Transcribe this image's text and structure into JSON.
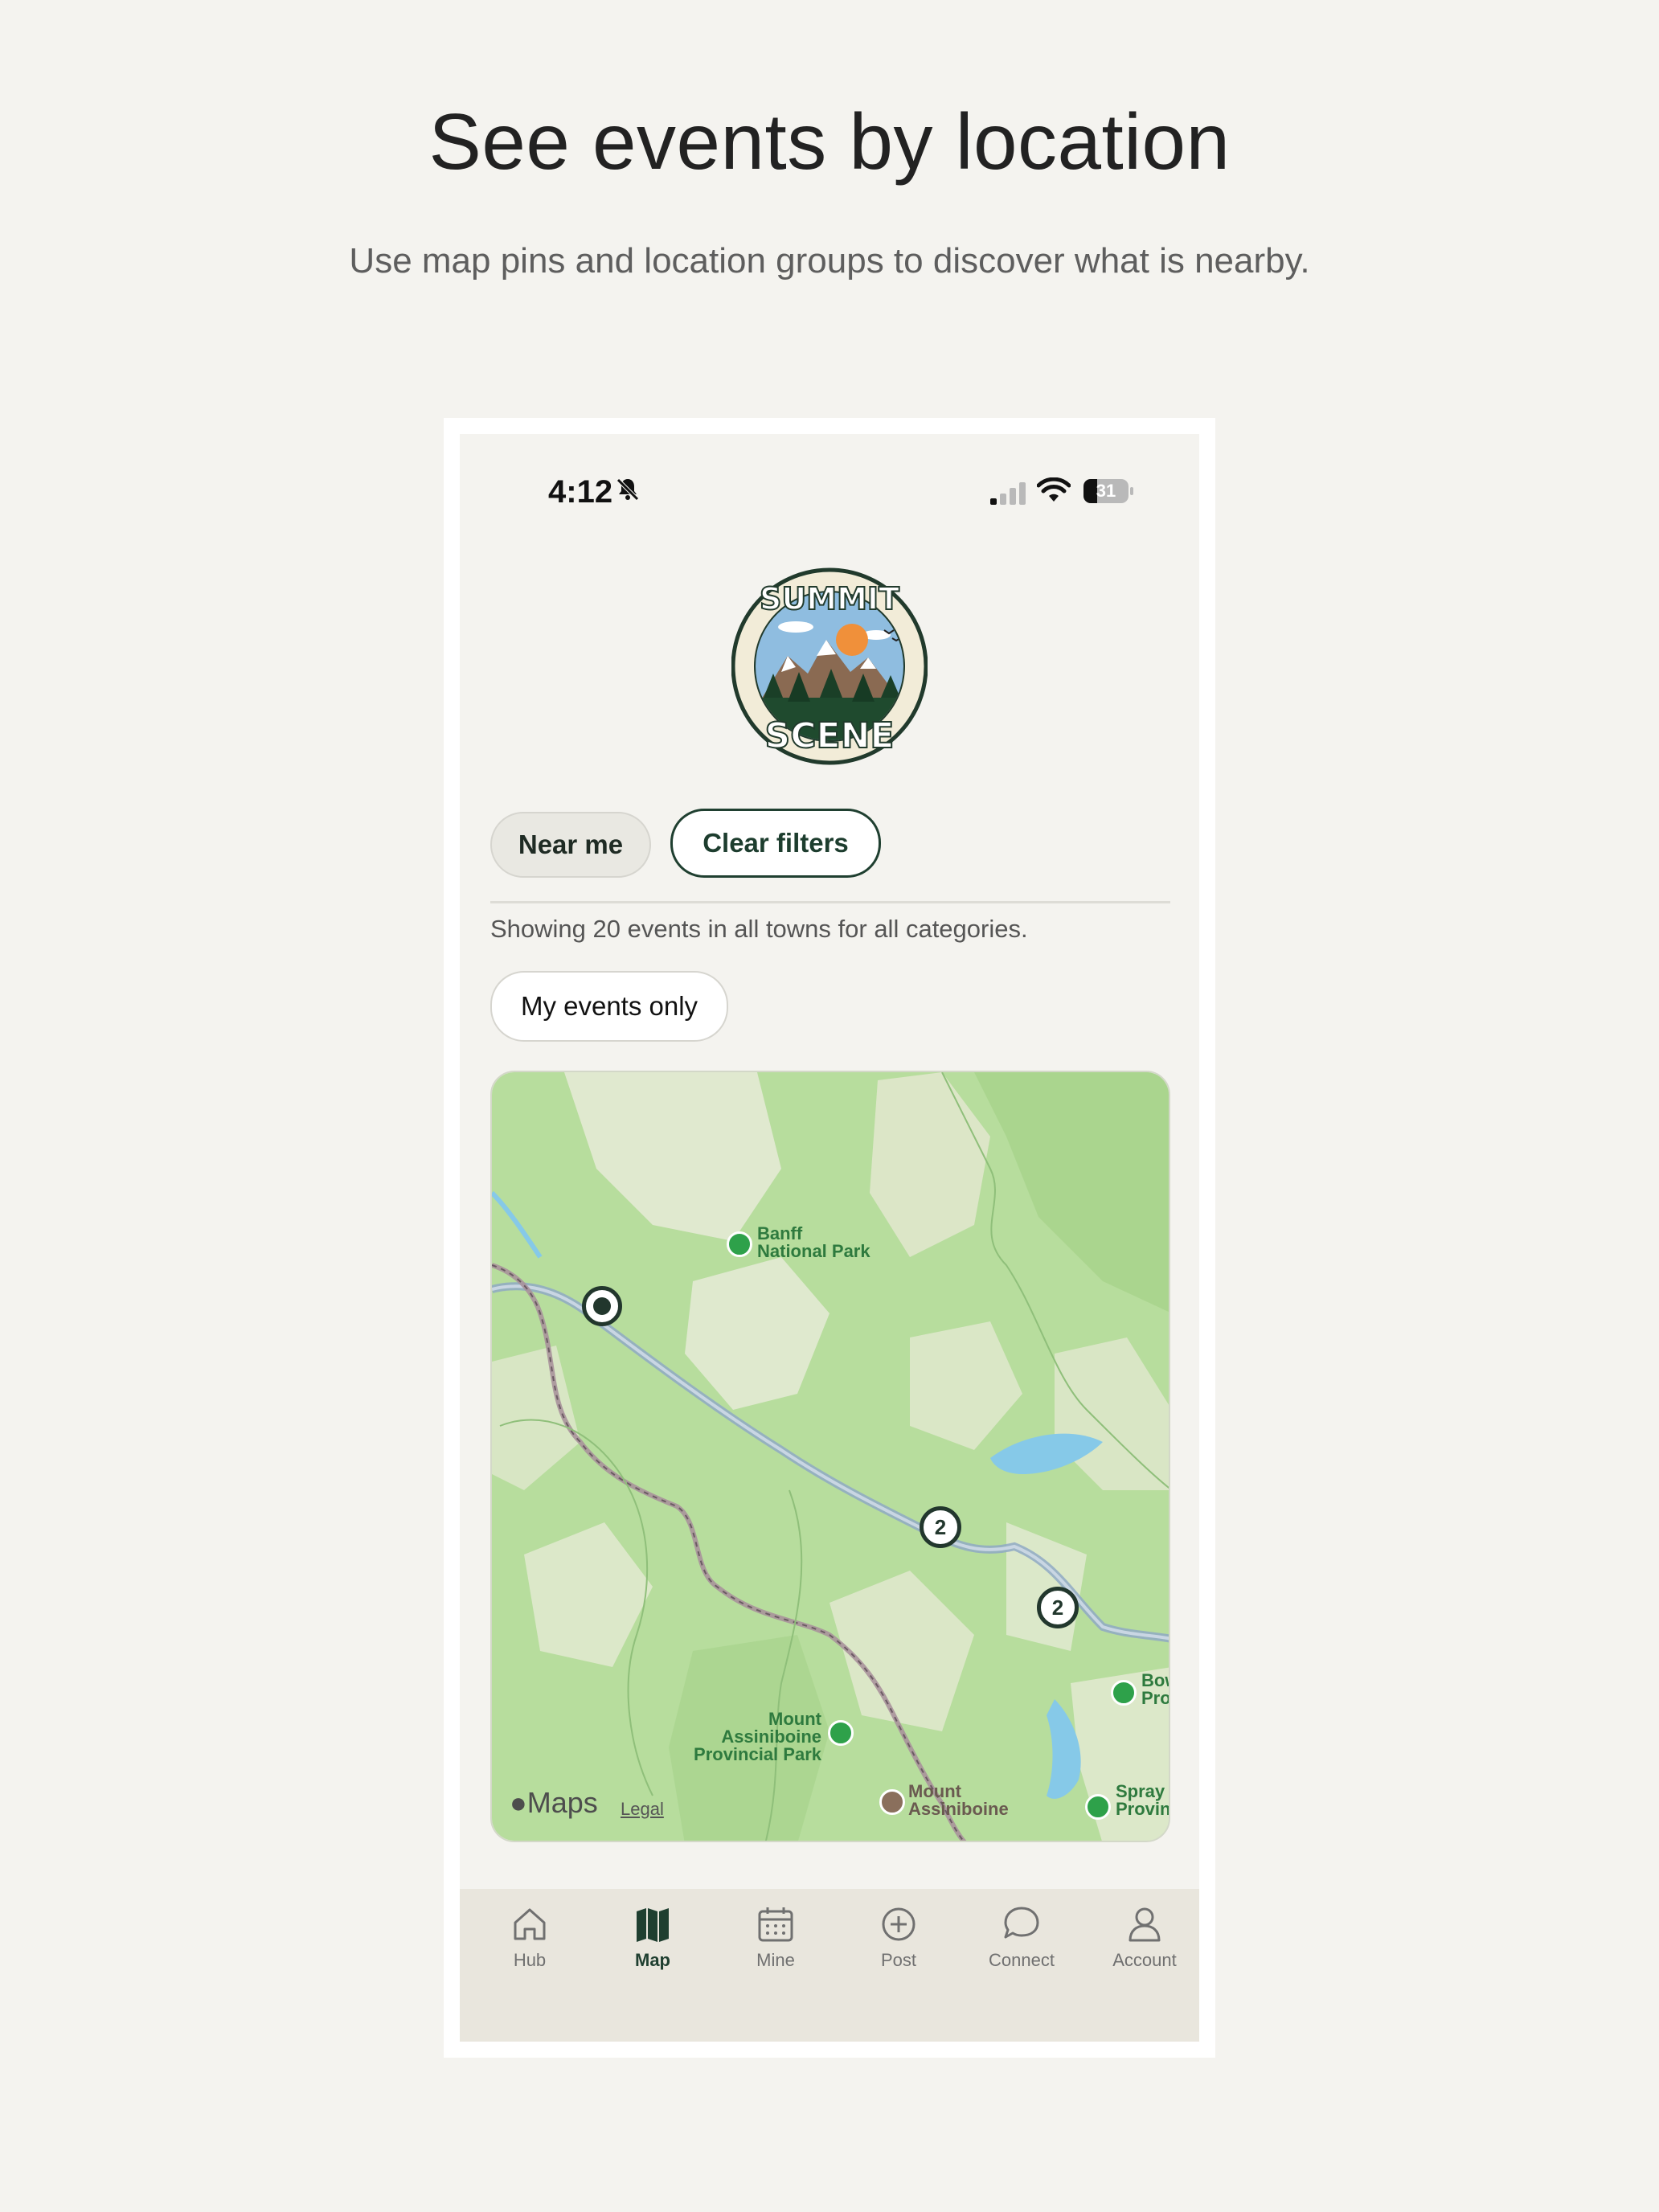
{
  "page": {
    "title": "See events by location",
    "subtitle": "Use map pins and location groups to discover what is nearby."
  },
  "status_bar": {
    "time": "4:12",
    "battery_level": "31"
  },
  "filters": {
    "near_me_label": "Near me",
    "clear_filters_label": "Clear filters",
    "showing_text": "Showing 20 events in all towns for all categories.",
    "my_events_label": "My events only"
  },
  "map": {
    "brand": "Maps",
    "legal": "Legal",
    "pois": {
      "banff": [
        "Banff",
        "National Park"
      ],
      "assiniboine_park": [
        "Mount",
        "Assiniboine",
        "Provincial Park"
      ],
      "assiniboine_peak": [
        "Mount",
        "Assiniboine"
      ],
      "bow": [
        "Bow",
        "Pro"
      ],
      "spray": [
        "Spray",
        "Provin"
      ]
    },
    "clusters": [
      {
        "count": "2"
      },
      {
        "count": "2"
      }
    ]
  },
  "tabs": [
    {
      "label": "Hub",
      "icon": "home-icon",
      "active": false
    },
    {
      "label": "Map",
      "icon": "map-icon",
      "active": true
    },
    {
      "label": "Mine",
      "icon": "calendar-icon",
      "active": false
    },
    {
      "label": "Post",
      "icon": "plus-circle-icon",
      "active": false
    },
    {
      "label": "Connect",
      "icon": "chat-icon",
      "active": false
    },
    {
      "label": "Account",
      "icon": "person-icon",
      "active": false
    }
  ],
  "colors": {
    "background": "#f4f3ef",
    "accent": "#1f3f30",
    "map_green": "#b7dd9d",
    "tabbar": "#e9e6dd"
  }
}
